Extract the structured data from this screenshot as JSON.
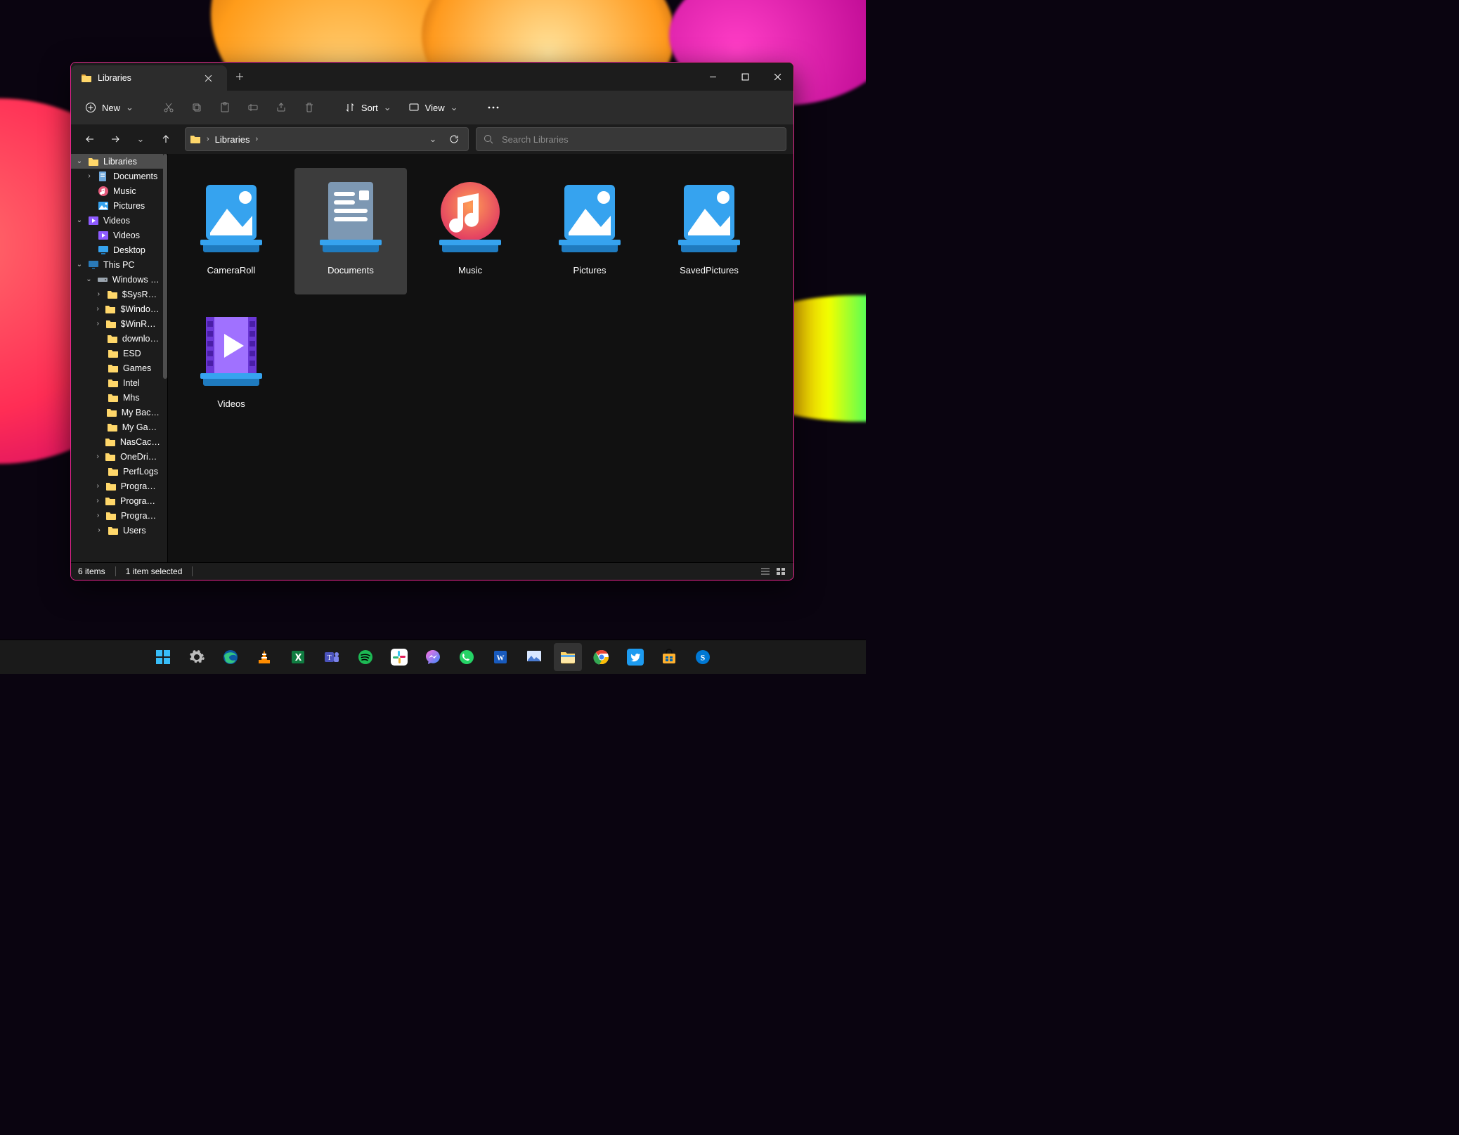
{
  "window": {
    "tab_title": "Libraries"
  },
  "toolbar": {
    "new_label": "New",
    "sort_label": "Sort",
    "view_label": "View"
  },
  "breadcrumb": {
    "root": "Libraries"
  },
  "search": {
    "placeholder": "Search Libraries"
  },
  "tree": [
    {
      "indent": 0,
      "twisty": "v",
      "icon": "folder",
      "label": "Libraries",
      "selected": true
    },
    {
      "indent": 1,
      "twisty": ">",
      "icon": "docs",
      "label": "Documents"
    },
    {
      "indent": 1,
      "twisty": "",
      "icon": "music",
      "label": "Music"
    },
    {
      "indent": 1,
      "twisty": "",
      "icon": "pics",
      "label": "Pictures"
    },
    {
      "indent": 0,
      "twisty": "v",
      "icon": "videos",
      "label": "Videos"
    },
    {
      "indent": 1,
      "twisty": "",
      "icon": "videos",
      "label": "Videos"
    },
    {
      "indent": 1,
      "twisty": "",
      "icon": "desktop",
      "label": "Desktop"
    },
    {
      "indent": 0,
      "twisty": "v",
      "icon": "pc",
      "label": "This PC"
    },
    {
      "indent": 1,
      "twisty": "v",
      "icon": "drive",
      "label": "Windows (C:)"
    },
    {
      "indent": 2,
      "twisty": ">",
      "icon": "folder",
      "label": "$SysReset"
    },
    {
      "indent": 2,
      "twisty": ">",
      "icon": "folder",
      "label": "$Windows.~W"
    },
    {
      "indent": 2,
      "twisty": ">",
      "icon": "folder",
      "label": "$WinREAgent"
    },
    {
      "indent": 2,
      "twisty": "",
      "icon": "folder",
      "label": "downloads"
    },
    {
      "indent": 2,
      "twisty": "",
      "icon": "folder",
      "label": "ESD"
    },
    {
      "indent": 2,
      "twisty": "",
      "icon": "folder",
      "label": "Games"
    },
    {
      "indent": 2,
      "twisty": "",
      "icon": "folder",
      "label": "Intel"
    },
    {
      "indent": 2,
      "twisty": "",
      "icon": "folder",
      "label": "Mhs"
    },
    {
      "indent": 2,
      "twisty": "",
      "icon": "folder",
      "label": "My Backups"
    },
    {
      "indent": 2,
      "twisty": "",
      "icon": "folder",
      "label": "My Games"
    },
    {
      "indent": 2,
      "twisty": "",
      "icon": "folder",
      "label": "NasCacheDirec"
    },
    {
      "indent": 2,
      "twisty": ">",
      "icon": "folder",
      "label": "OneDriveTemp"
    },
    {
      "indent": 2,
      "twisty": "",
      "icon": "folder",
      "label": "PerfLogs"
    },
    {
      "indent": 2,
      "twisty": ">",
      "icon": "folder",
      "label": "Program Files"
    },
    {
      "indent": 2,
      "twisty": ">",
      "icon": "folder",
      "label": "Program Files ("
    },
    {
      "indent": 2,
      "twisty": ">",
      "icon": "folder",
      "label": "ProgramData"
    },
    {
      "indent": 2,
      "twisty": ">",
      "icon": "folder",
      "label": "Users"
    }
  ],
  "items": [
    {
      "label": "CameraRoll",
      "icon": "picture",
      "selected": false
    },
    {
      "label": "Documents",
      "icon": "document",
      "selected": true
    },
    {
      "label": "Music",
      "icon": "music",
      "selected": false
    },
    {
      "label": "Pictures",
      "icon": "picture",
      "selected": false
    },
    {
      "label": "SavedPictures",
      "icon": "picture",
      "selected": false
    },
    {
      "label": "Videos",
      "icon": "video",
      "selected": false
    }
  ],
  "status": {
    "count": "6 items",
    "selection": "1 item selected"
  },
  "taskbar": [
    {
      "name": "start",
      "active": false
    },
    {
      "name": "settings",
      "active": false
    },
    {
      "name": "edge",
      "active": false
    },
    {
      "name": "vlc",
      "active": false
    },
    {
      "name": "excel",
      "active": false
    },
    {
      "name": "teams",
      "active": false
    },
    {
      "name": "spotify",
      "active": false
    },
    {
      "name": "slack",
      "active": false
    },
    {
      "name": "messenger",
      "active": false
    },
    {
      "name": "whatsapp",
      "active": false
    },
    {
      "name": "word",
      "active": false
    },
    {
      "name": "paint",
      "active": false
    },
    {
      "name": "explorer",
      "active": true
    },
    {
      "name": "chrome",
      "active": false
    },
    {
      "name": "twitter",
      "active": false
    },
    {
      "name": "store",
      "active": false
    },
    {
      "name": "skype",
      "active": false
    }
  ]
}
